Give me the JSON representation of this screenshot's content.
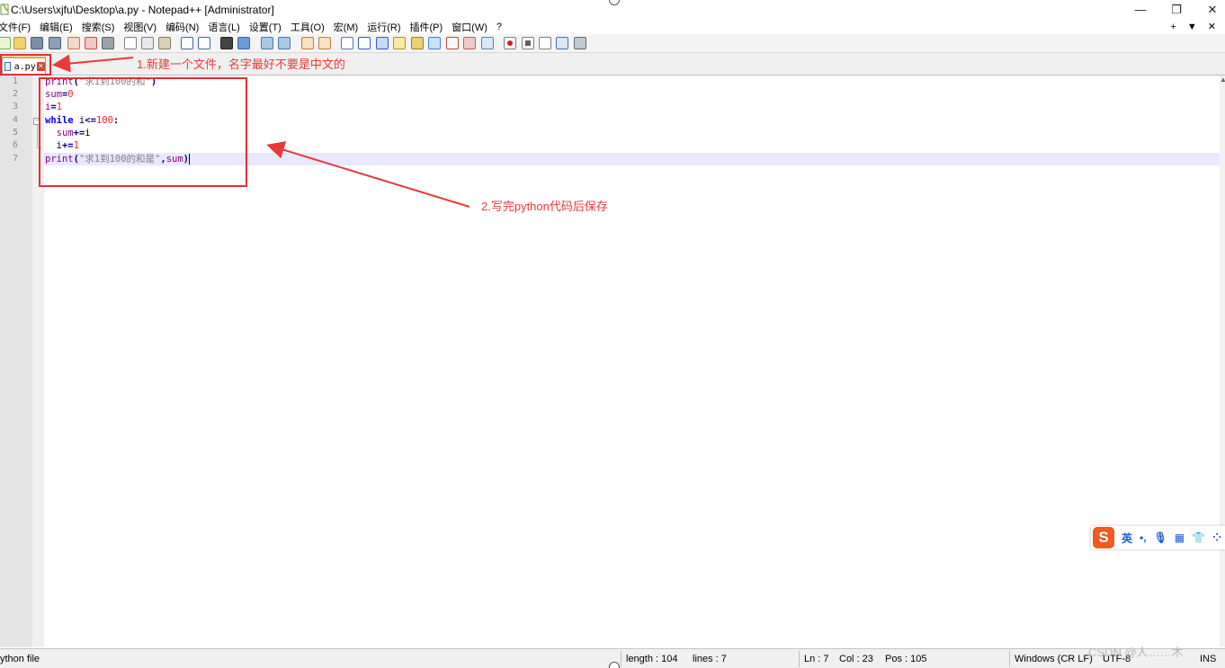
{
  "window": {
    "title": "C:\\Users\\xjfu\\Desktop\\a.py - Notepad++ [Administrator]",
    "minimize": "—",
    "maximize": "❐",
    "close": "✕"
  },
  "menu": {
    "items": [
      "文件(F)",
      "编辑(E)",
      "搜索(S)",
      "视图(V)",
      "编码(N)",
      "语言(L)",
      "设置(T)",
      "工具(O)",
      "宏(M)",
      "运行(R)",
      "插件(P)",
      "窗口(W)",
      "?"
    ],
    "right": [
      "+",
      "▼",
      "✕"
    ]
  },
  "tab": {
    "label": "a.py",
    "close": "✕"
  },
  "editor": {
    "line_numbers": [
      "1",
      "2",
      "3",
      "4",
      "5",
      "6",
      "7"
    ],
    "code": {
      "l1_fn": "print",
      "l1_open": "(",
      "l1_str": "\"求1到100的和\"",
      "l1_close": ")",
      "l2_var": "sum",
      "l2_op": "=",
      "l2_num": "0",
      "l3_var": "i",
      "l3_op": "=",
      "l3_num": "1",
      "l4_kw": "while",
      "l4_var": " i",
      "l4_op": "<=",
      "l4_num": "100",
      "l4_colon": ":",
      "l5_indent": "  ",
      "l5_var": "sum",
      "l5_op": "+=",
      "l5_var2": "i",
      "l6_indent": "  ",
      "l6_var": "i",
      "l6_op": "+=",
      "l6_num": "1",
      "l7_fn": "print",
      "l7_open": "(",
      "l7_str": "\"求1到100的和是\"",
      "l7_comma": ",",
      "l7_var": "sum",
      "l7_close": ")"
    }
  },
  "annotations": {
    "step1": "1.新建一个文件，名字最好不要是中文的",
    "step2": "2.写完python代码后保存",
    "color": "#e83a3a"
  },
  "ime": {
    "logo": "S",
    "items": [
      "英",
      "•,",
      "🎙",
      "▦",
      "👕",
      "⁘"
    ]
  },
  "status": {
    "file_type": "ython file",
    "length": "length : 104",
    "lines": "lines : 7",
    "ln": "Ln : 7",
    "col": "Col : 23",
    "pos": "Pos : 105",
    "eol": "Windows (CR LF)",
    "encoding": "UTF-8",
    "mode": "INS"
  },
  "watermark": "CSDN @人……木",
  "colors": {
    "keyword": "#0000ff",
    "string": "#808080",
    "number": "#ff2020",
    "current_line": "#e8e8ff",
    "tab_accent": "#f2a33a"
  }
}
